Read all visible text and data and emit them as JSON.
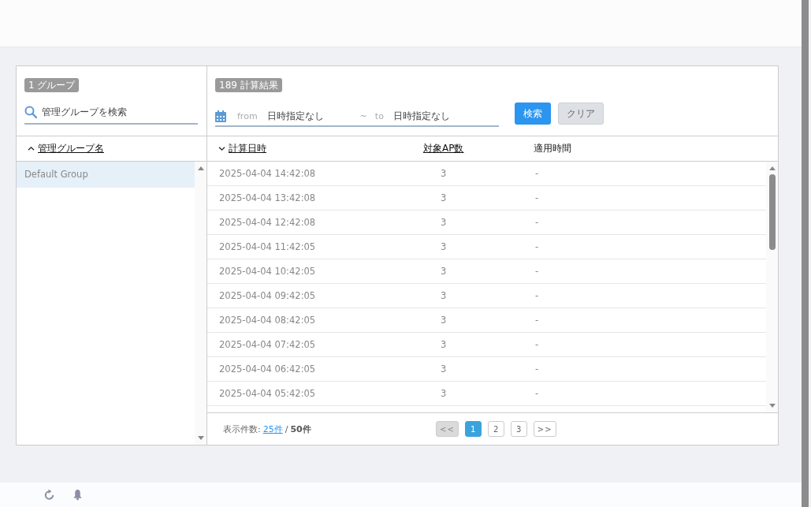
{
  "group_panel": {
    "count_badge": "1 グループ",
    "search": {
      "placeholder": "管理グループを検索"
    },
    "column": {
      "label": "管理グループ名",
      "sorted": true,
      "ascending": true,
      "sortable": true
    },
    "items": [
      {
        "label": "Default Group",
        "selected": true
      }
    ]
  },
  "results_panel": {
    "count_badge": "189 計算結果",
    "date_filter": {
      "from_label": "from",
      "from_placeholder": "日時指定なし",
      "separator": "~",
      "to_label": "to",
      "to_placeholder": "日時指定なし"
    },
    "buttons": [
      {
        "label": "検索",
        "kind": "primary"
      },
      {
        "label": "クリア",
        "kind": "secondary"
      }
    ],
    "columns": [
      {
        "label": "計算日時",
        "sorted": true,
        "ascending": false,
        "sortable": true
      },
      {
        "label": "対象AP数",
        "sorted": false,
        "sortable": true
      },
      {
        "label": "適用時間",
        "sorted": false,
        "sortable": false
      }
    ],
    "rows": [
      [
        "2025-04-04 14:42:08",
        "3",
        "-"
      ],
      [
        "2025-04-04 13:42:08",
        "3",
        "-"
      ],
      [
        "2025-04-04 12:42:08",
        "3",
        "-"
      ],
      [
        "2025-04-04 11:42:05",
        "3",
        "-"
      ],
      [
        "2025-04-04 10:42:05",
        "3",
        "-"
      ],
      [
        "2025-04-04 09:42:05",
        "3",
        "-"
      ],
      [
        "2025-04-04 08:42:05",
        "3",
        "-"
      ],
      [
        "2025-04-04 07:42:05",
        "3",
        "-"
      ],
      [
        "2025-04-04 06:42:05",
        "3",
        "-"
      ],
      [
        "2025-04-04 05:42:05",
        "3",
        "-"
      ]
    ],
    "footer": {
      "label": "表示件数:",
      "page_size": "25件",
      "separator": "/",
      "total": "50件"
    },
    "pagination": [
      {
        "label": "<<",
        "kind": "nav",
        "disabled": true,
        "selected": false
      },
      {
        "label": "1",
        "kind": "page",
        "disabled": false,
        "selected": true
      },
      {
        "label": "2",
        "kind": "page",
        "disabled": false,
        "selected": false
      },
      {
        "label": "3",
        "kind": "page",
        "disabled": false,
        "selected": false
      },
      {
        "label": ">>",
        "kind": "nav",
        "disabled": false,
        "selected": false
      }
    ]
  }
}
